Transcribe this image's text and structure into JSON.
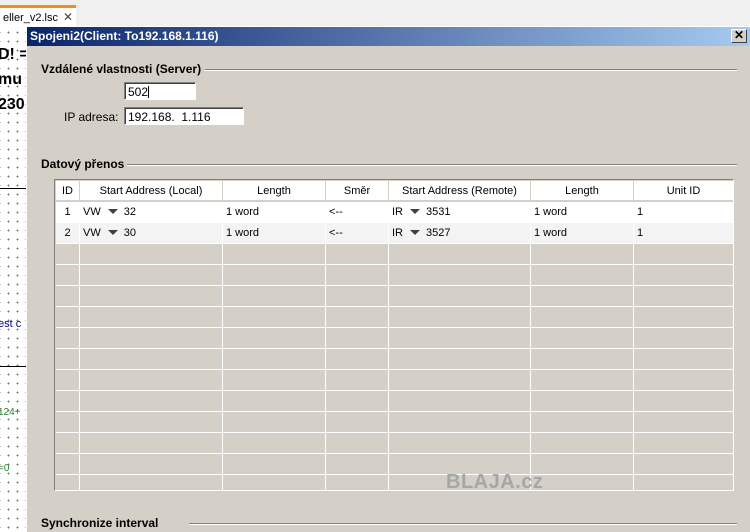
{
  "background_editor": {
    "tab_label": "eller_v2.lsc",
    "tab_close": "✕",
    "fragments": [
      "D! =",
      "mu",
      "230",
      "est c",
      "124+",
      "=0"
    ]
  },
  "dialog": {
    "title": "Spojeni2(Client: To192.168.1.116)",
    "close": "✕",
    "server_group": {
      "title": "Vzdálené vlastnosti (Server)",
      "port_value": "502",
      "ip_label": "IP adresa:",
      "ip_value": "192.168.  1.116"
    },
    "transfer_group": {
      "title": "Datový přenos",
      "columns": [
        "ID",
        "Start Address (Local)",
        "Length",
        "Směr",
        "Start Address (Remote)",
        "Length",
        "Unit ID"
      ],
      "rows": [
        {
          "id": "1",
          "local_type": "VW",
          "local_addr": "32",
          "length": "1 word",
          "dir": "<--",
          "remote_type": "IR",
          "remote_addr": "3531",
          "remote_length": "1 word",
          "unit_id": "1"
        },
        {
          "id": "2",
          "local_type": "VW",
          "local_addr": "30",
          "length": "1 word",
          "dir": "<--",
          "remote_type": "IR",
          "remote_addr": "3527",
          "remote_length": "1 word",
          "unit_id": "1"
        }
      ]
    },
    "watermark": "BLAJA.cz",
    "sync_group": {
      "title": "Synchronize interval"
    }
  }
}
